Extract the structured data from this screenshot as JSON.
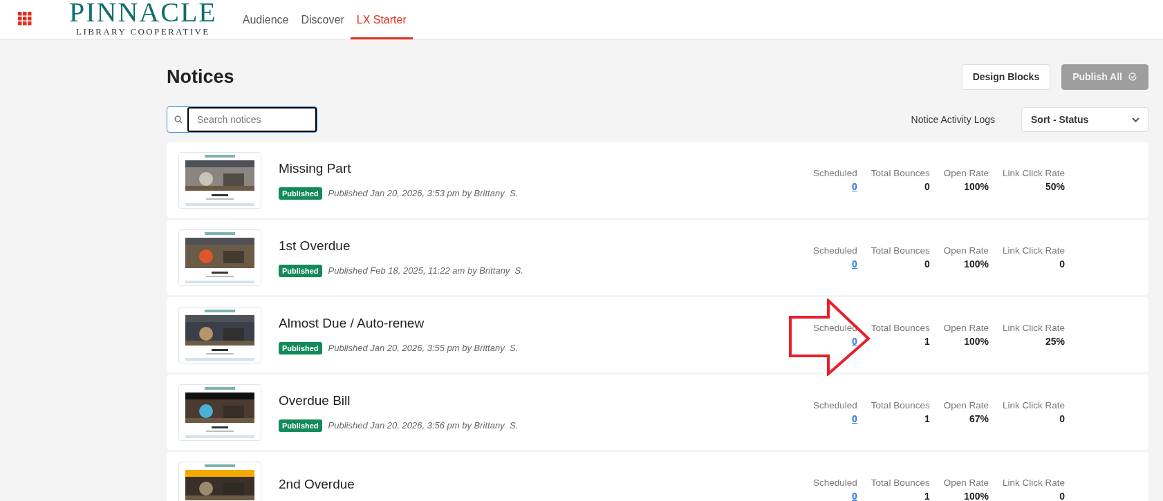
{
  "header": {
    "logo": {
      "name": "PINNACLE",
      "tagline": "LIBRARY COOPERATIVE"
    },
    "nav": [
      {
        "label": "Audience",
        "selected": false
      },
      {
        "label": "Discover",
        "selected": false
      },
      {
        "label": "LX Starter",
        "selected": true
      }
    ]
  },
  "page": {
    "title": "Notices",
    "buttons": [
      {
        "label": "Design Blocks",
        "disabled": false
      },
      {
        "label": "Publish All",
        "disabled": true
      }
    ]
  },
  "search": {
    "placeholder": "Search notices"
  },
  "activity_link": "Notice Activity Logs",
  "sort": {
    "value": "Sort - Status"
  },
  "notices": [
    {
      "title": "Missing Part",
      "status": "Published",
      "published": "Published Jan 20, 2026, 3:53 pm by Brittany  S.",
      "stats": [
        {
          "kind": "link",
          "label": "Scheduled",
          "value": "0"
        },
        {
          "kind": "value",
          "label": "Total Bounces",
          "value": "0"
        },
        {
          "kind": "value",
          "label": "Open Rate",
          "value": "100%"
        },
        {
          "kind": "value",
          "label": "Link Click Rate",
          "value": "50%"
        }
      ]
    },
    {
      "title": "1st Overdue",
      "status": "Published",
      "published": "Published Feb 18, 2025, 11:22 am by Brittany  S.",
      "stats": [
        {
          "kind": "link",
          "label": "Scheduled",
          "value": "0"
        },
        {
          "kind": "value",
          "label": "Total Bounces",
          "value": "0"
        },
        {
          "kind": "value",
          "label": "Open Rate",
          "value": "100%"
        },
        {
          "kind": "value",
          "label": "Link Click Rate",
          "value": "0"
        }
      ]
    },
    {
      "title": "Almost Due / Auto-renew",
      "status": "Published",
      "published": "Published Jan 20, 2026, 3:55 pm by Brittany  S.",
      "stats": [
        {
          "kind": "link",
          "label": "Scheduled",
          "value": "0"
        },
        {
          "kind": "value",
          "label": "Total Bounces",
          "value": "1"
        },
        {
          "kind": "value",
          "label": "Open Rate",
          "value": "100%"
        },
        {
          "kind": "value",
          "label": "Link Click Rate",
          "value": "25%"
        }
      ]
    },
    {
      "title": "Overdue Bill",
      "status": "Published",
      "published": "Published Jan 20, 2026, 3:56 pm by Brittany  S.",
      "stats": [
        {
          "kind": "link",
          "label": "Scheduled",
          "value": "0"
        },
        {
          "kind": "value",
          "label": "Total Bounces",
          "value": "1"
        },
        {
          "kind": "value",
          "label": "Open Rate",
          "value": "67%"
        },
        {
          "kind": "value",
          "label": "Link Click Rate",
          "value": "0"
        }
      ]
    },
    {
      "title": "2nd Overdue",
      "stats": [
        {
          "kind": "link",
          "label": "Scheduled",
          "value": "0"
        },
        {
          "kind": "value",
          "label": "Total Bounces",
          "value": "1"
        },
        {
          "kind": "value",
          "label": "Open Rate",
          "value": "100%"
        },
        {
          "kind": "value",
          "label": "Link Click Rate",
          "value": "0"
        }
      ]
    }
  ]
}
